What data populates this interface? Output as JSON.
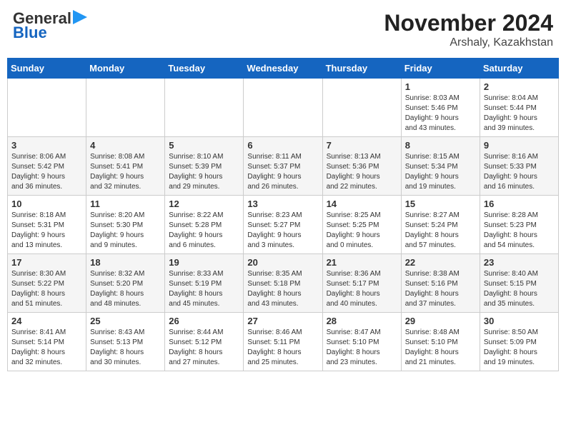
{
  "header": {
    "logo_line1": "General",
    "logo_line2": "Blue",
    "month": "November 2024",
    "location": "Arshaly, Kazakhstan"
  },
  "days_of_week": [
    "Sunday",
    "Monday",
    "Tuesday",
    "Wednesday",
    "Thursday",
    "Friday",
    "Saturday"
  ],
  "weeks": [
    [
      {
        "day": "",
        "detail": ""
      },
      {
        "day": "",
        "detail": ""
      },
      {
        "day": "",
        "detail": ""
      },
      {
        "day": "",
        "detail": ""
      },
      {
        "day": "",
        "detail": ""
      },
      {
        "day": "1",
        "detail": "Sunrise: 8:03 AM\nSunset: 5:46 PM\nDaylight: 9 hours\nand 43 minutes."
      },
      {
        "day": "2",
        "detail": "Sunrise: 8:04 AM\nSunset: 5:44 PM\nDaylight: 9 hours\nand 39 minutes."
      }
    ],
    [
      {
        "day": "3",
        "detail": "Sunrise: 8:06 AM\nSunset: 5:42 PM\nDaylight: 9 hours\nand 36 minutes."
      },
      {
        "day": "4",
        "detail": "Sunrise: 8:08 AM\nSunset: 5:41 PM\nDaylight: 9 hours\nand 32 minutes."
      },
      {
        "day": "5",
        "detail": "Sunrise: 8:10 AM\nSunset: 5:39 PM\nDaylight: 9 hours\nand 29 minutes."
      },
      {
        "day": "6",
        "detail": "Sunrise: 8:11 AM\nSunset: 5:37 PM\nDaylight: 9 hours\nand 26 minutes."
      },
      {
        "day": "7",
        "detail": "Sunrise: 8:13 AM\nSunset: 5:36 PM\nDaylight: 9 hours\nand 22 minutes."
      },
      {
        "day": "8",
        "detail": "Sunrise: 8:15 AM\nSunset: 5:34 PM\nDaylight: 9 hours\nand 19 minutes."
      },
      {
        "day": "9",
        "detail": "Sunrise: 8:16 AM\nSunset: 5:33 PM\nDaylight: 9 hours\nand 16 minutes."
      }
    ],
    [
      {
        "day": "10",
        "detail": "Sunrise: 8:18 AM\nSunset: 5:31 PM\nDaylight: 9 hours\nand 13 minutes."
      },
      {
        "day": "11",
        "detail": "Sunrise: 8:20 AM\nSunset: 5:30 PM\nDaylight: 9 hours\nand 9 minutes."
      },
      {
        "day": "12",
        "detail": "Sunrise: 8:22 AM\nSunset: 5:28 PM\nDaylight: 9 hours\nand 6 minutes."
      },
      {
        "day": "13",
        "detail": "Sunrise: 8:23 AM\nSunset: 5:27 PM\nDaylight: 9 hours\nand 3 minutes."
      },
      {
        "day": "14",
        "detail": "Sunrise: 8:25 AM\nSunset: 5:25 PM\nDaylight: 9 hours\nand 0 minutes."
      },
      {
        "day": "15",
        "detail": "Sunrise: 8:27 AM\nSunset: 5:24 PM\nDaylight: 8 hours\nand 57 minutes."
      },
      {
        "day": "16",
        "detail": "Sunrise: 8:28 AM\nSunset: 5:23 PM\nDaylight: 8 hours\nand 54 minutes."
      }
    ],
    [
      {
        "day": "17",
        "detail": "Sunrise: 8:30 AM\nSunset: 5:22 PM\nDaylight: 8 hours\nand 51 minutes."
      },
      {
        "day": "18",
        "detail": "Sunrise: 8:32 AM\nSunset: 5:20 PM\nDaylight: 8 hours\nand 48 minutes."
      },
      {
        "day": "19",
        "detail": "Sunrise: 8:33 AM\nSunset: 5:19 PM\nDaylight: 8 hours\nand 45 minutes."
      },
      {
        "day": "20",
        "detail": "Sunrise: 8:35 AM\nSunset: 5:18 PM\nDaylight: 8 hours\nand 43 minutes."
      },
      {
        "day": "21",
        "detail": "Sunrise: 8:36 AM\nSunset: 5:17 PM\nDaylight: 8 hours\nand 40 minutes."
      },
      {
        "day": "22",
        "detail": "Sunrise: 8:38 AM\nSunset: 5:16 PM\nDaylight: 8 hours\nand 37 minutes."
      },
      {
        "day": "23",
        "detail": "Sunrise: 8:40 AM\nSunset: 5:15 PM\nDaylight: 8 hours\nand 35 minutes."
      }
    ],
    [
      {
        "day": "24",
        "detail": "Sunrise: 8:41 AM\nSunset: 5:14 PM\nDaylight: 8 hours\nand 32 minutes."
      },
      {
        "day": "25",
        "detail": "Sunrise: 8:43 AM\nSunset: 5:13 PM\nDaylight: 8 hours\nand 30 minutes."
      },
      {
        "day": "26",
        "detail": "Sunrise: 8:44 AM\nSunset: 5:12 PM\nDaylight: 8 hours\nand 27 minutes."
      },
      {
        "day": "27",
        "detail": "Sunrise: 8:46 AM\nSunset: 5:11 PM\nDaylight: 8 hours\nand 25 minutes."
      },
      {
        "day": "28",
        "detail": "Sunrise: 8:47 AM\nSunset: 5:10 PM\nDaylight: 8 hours\nand 23 minutes."
      },
      {
        "day": "29",
        "detail": "Sunrise: 8:48 AM\nSunset: 5:10 PM\nDaylight: 8 hours\nand 21 minutes."
      },
      {
        "day": "30",
        "detail": "Sunrise: 8:50 AM\nSunset: 5:09 PM\nDaylight: 8 hours\nand 19 minutes."
      }
    ]
  ]
}
